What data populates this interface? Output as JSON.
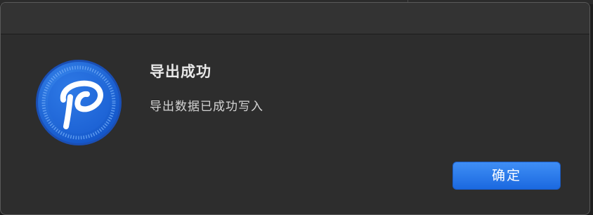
{
  "dialog": {
    "title": "导出成功",
    "message": "导出数据已成功写入",
    "ok_label": "确定"
  },
  "icons": {
    "app": "app-logo-icon"
  },
  "colors": {
    "accent": "#2a79e8",
    "dialog_bg": "#2d2d2d"
  }
}
